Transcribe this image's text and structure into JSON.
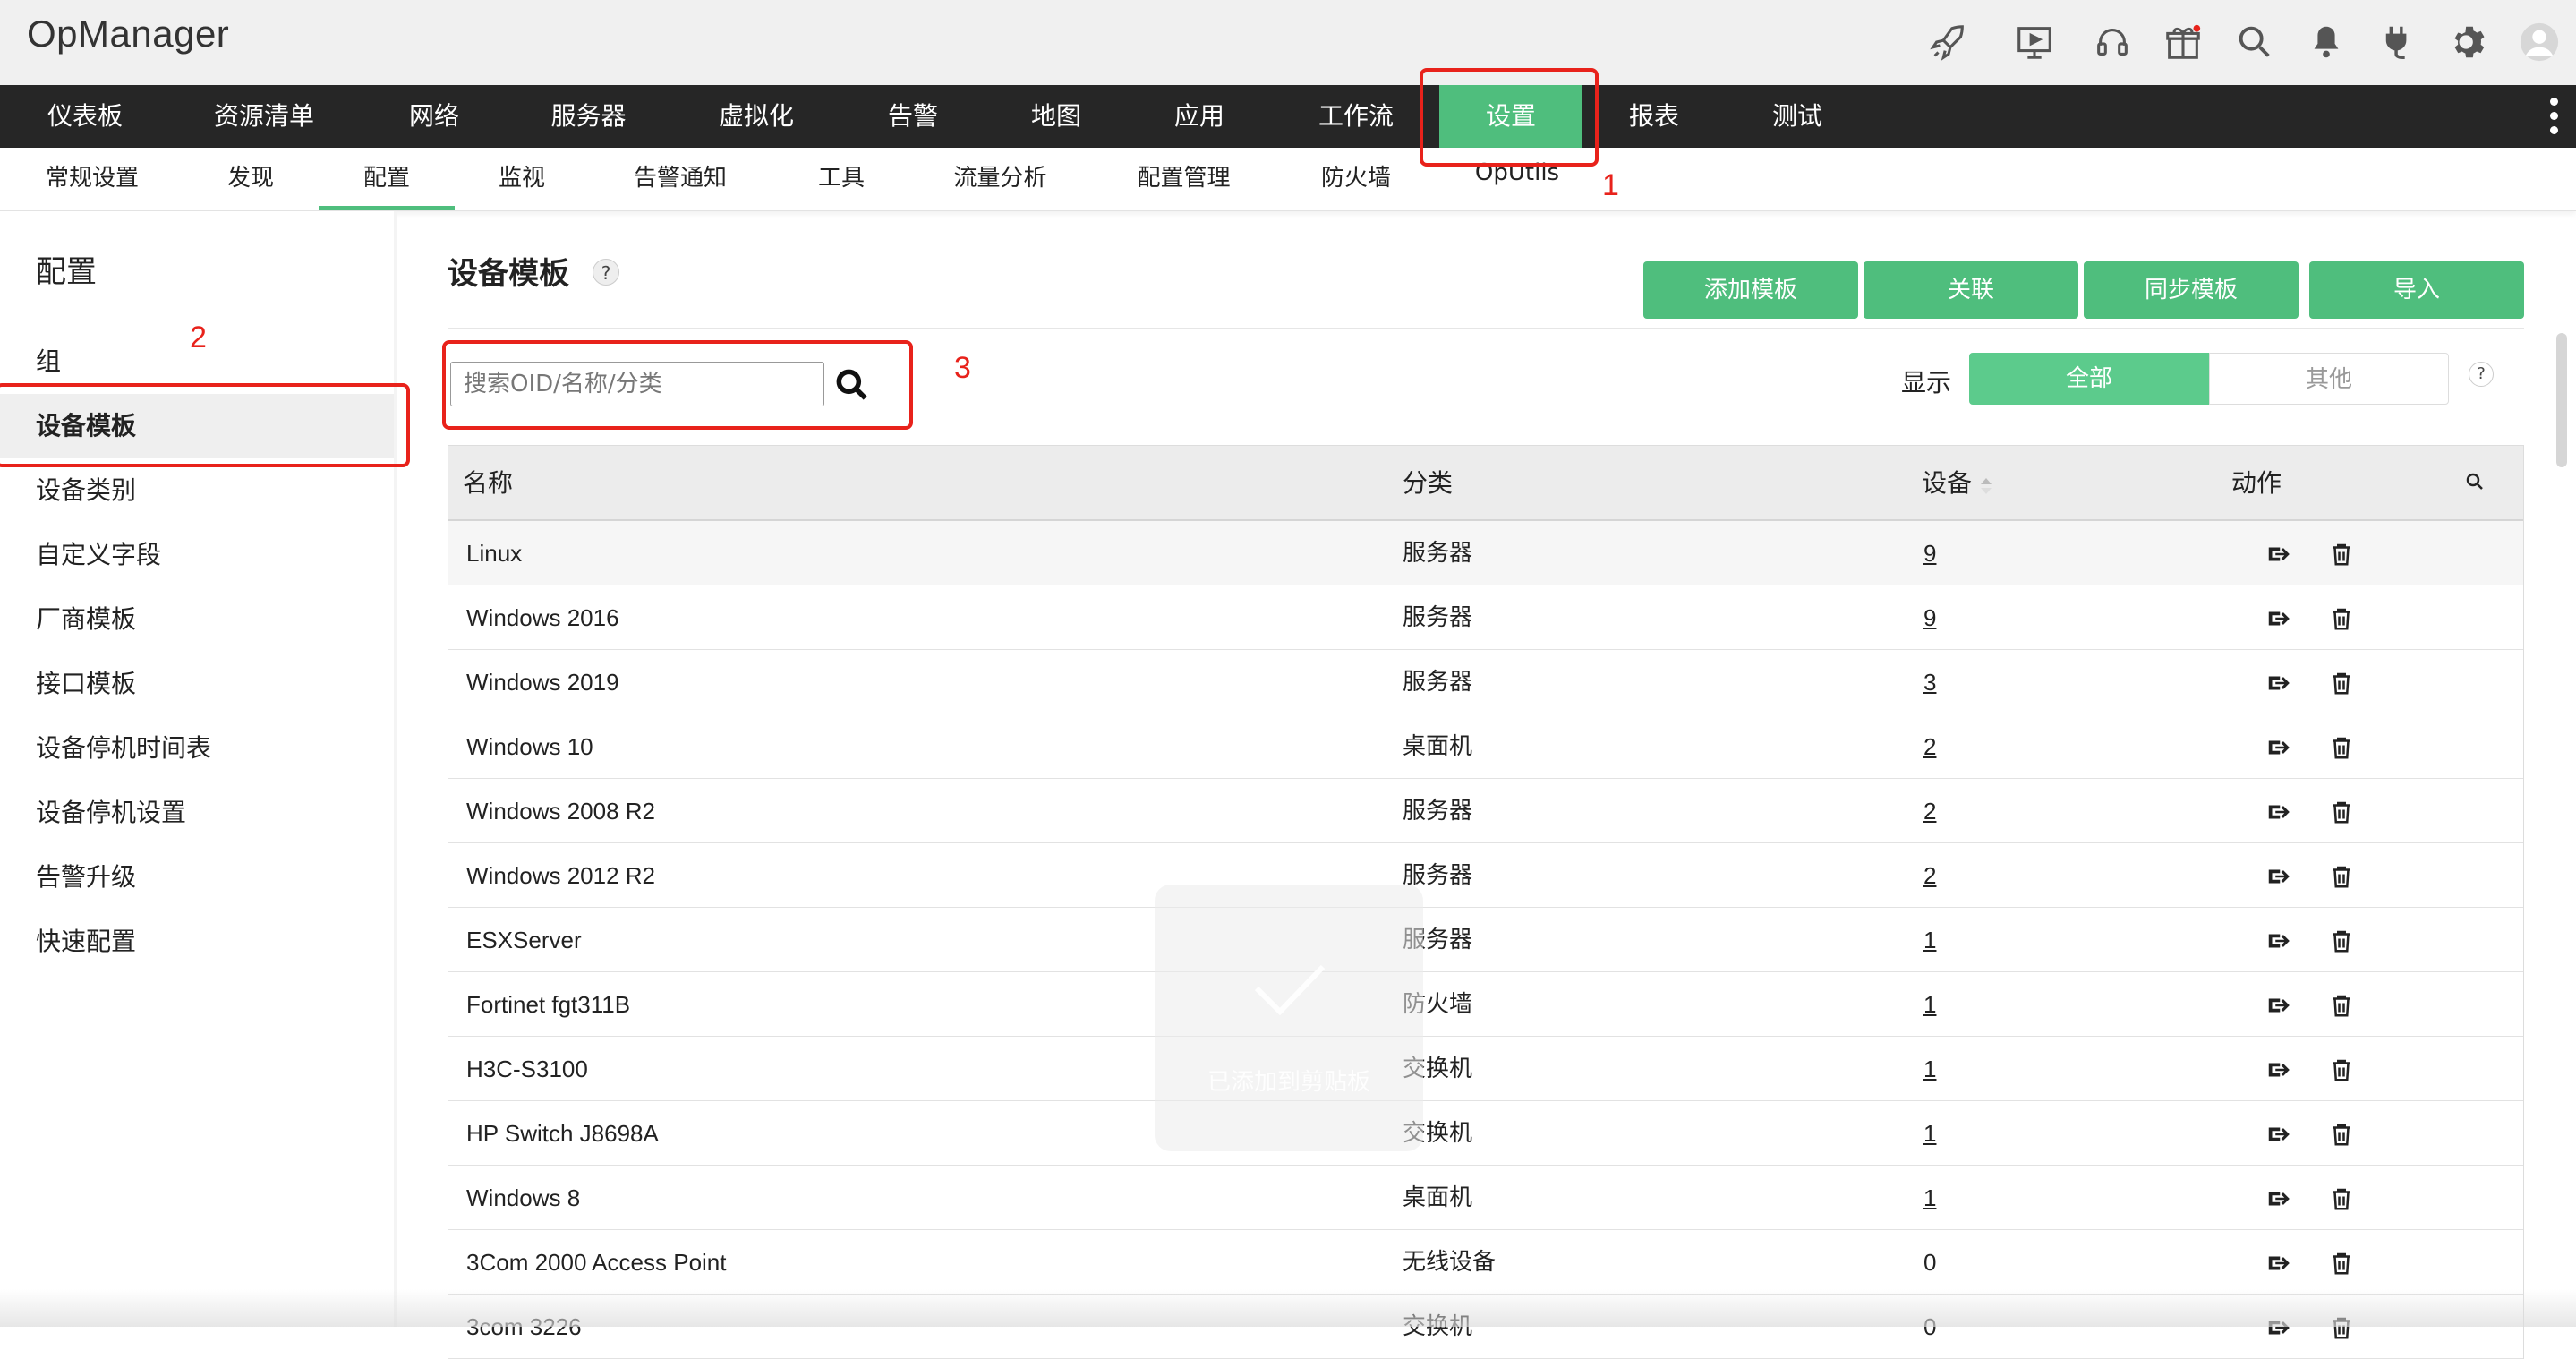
{
  "app": {
    "title": "OpManager"
  },
  "topbar": {
    "icons": [
      "rocket-icon",
      "presentation-icon",
      "headset-icon",
      "gift-icon",
      "search-icon",
      "bell-icon",
      "plug-icon",
      "gear-icon",
      "user-avatar-icon"
    ]
  },
  "mainnav": {
    "items": [
      {
        "label": "仪表板"
      },
      {
        "label": "资源清单"
      },
      {
        "label": "网络"
      },
      {
        "label": "服务器"
      },
      {
        "label": "虚拟化"
      },
      {
        "label": "告警"
      },
      {
        "label": "地图"
      },
      {
        "label": "应用"
      },
      {
        "label": "工作流"
      },
      {
        "label": "设置",
        "active": true
      },
      {
        "label": "报表"
      },
      {
        "label": "测试"
      }
    ]
  },
  "subnav": {
    "items": [
      {
        "label": "常规设置"
      },
      {
        "label": "发现"
      },
      {
        "label": "配置",
        "active": true
      },
      {
        "label": "监视"
      },
      {
        "label": "告警通知"
      },
      {
        "label": "工具"
      },
      {
        "label": "流量分析"
      },
      {
        "label": "配置管理"
      },
      {
        "label": "防火墙"
      },
      {
        "label": "OpUtils"
      }
    ]
  },
  "sidebar": {
    "title": "配置",
    "items": [
      {
        "label": "组"
      },
      {
        "label": "设备模板",
        "active": true
      },
      {
        "label": "设备类别"
      },
      {
        "label": "自定义字段"
      },
      {
        "label": "厂商模板"
      },
      {
        "label": "接口模板"
      },
      {
        "label": "设备停机时间表"
      },
      {
        "label": "设备停机设置"
      },
      {
        "label": "告警升级"
      },
      {
        "label": "快速配置"
      }
    ]
  },
  "content": {
    "title": "设备模板",
    "help": "?",
    "buttons": {
      "add": "添加模板",
      "associate": "关联",
      "sync": "同步模板",
      "import": "导入"
    },
    "search": {
      "placeholder": "搜索OID/名称/分类"
    },
    "filter": {
      "label": "显示",
      "all": "全部",
      "other": "其他",
      "help": "?"
    }
  },
  "table": {
    "headers": {
      "name": "名称",
      "category": "分类",
      "devices": "设备",
      "actions": "动作"
    },
    "rows": [
      {
        "name": "Linux",
        "category": "服务器",
        "devices": "9",
        "link": true
      },
      {
        "name": "Windows 2016",
        "category": "服务器",
        "devices": "9",
        "link": true
      },
      {
        "name": "Windows 2019",
        "category": "服务器",
        "devices": "3",
        "link": true
      },
      {
        "name": "Windows 10",
        "category": "桌面机",
        "devices": "2",
        "link": true
      },
      {
        "name": "Windows 2008 R2",
        "category": "服务器",
        "devices": "2",
        "link": true
      },
      {
        "name": "Windows 2012 R2",
        "category": "服务器",
        "devices": "2",
        "link": true
      },
      {
        "name": "ESXServer",
        "category": "服务器",
        "devices": "1",
        "link": true
      },
      {
        "name": "Fortinet fgt311B",
        "category": "防火墙",
        "devices": "1",
        "link": true
      },
      {
        "name": "H3C-S3100",
        "category": "交换机",
        "devices": "1",
        "link": true
      },
      {
        "name": "HP Switch J8698A",
        "category": "交换机",
        "devices": "1",
        "link": true
      },
      {
        "name": "Windows 8",
        "category": "桌面机",
        "devices": "1",
        "link": true
      },
      {
        "name": "3Com 2000 Access Point",
        "category": "无线设备",
        "devices": "0",
        "link": false
      },
      {
        "name": "3com 3226",
        "category": "交换机",
        "devices": "0",
        "link": false
      }
    ]
  },
  "toast": {
    "text": "已添加到剪贴板"
  },
  "annotations": {
    "one": "1",
    "two": "2",
    "three": "3",
    "color": "#e8221b"
  },
  "colors": {
    "accent": "#4fbe7d",
    "nav_bg": "#262626"
  }
}
